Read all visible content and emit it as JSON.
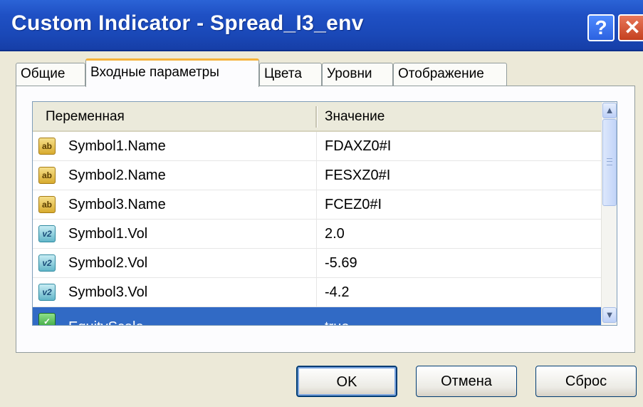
{
  "window": {
    "title": "Custom Indicator - Spread_I3_env"
  },
  "titlebar_buttons": {
    "help": "?",
    "close": "✕"
  },
  "tabs": [
    {
      "label": "Общие"
    },
    {
      "label": "Входные параметры"
    },
    {
      "label": "Цвета"
    },
    {
      "label": "Уровни"
    },
    {
      "label": "Отображение"
    }
  ],
  "table": {
    "headers": {
      "name": "Переменная",
      "value": "Значение"
    },
    "rows": [
      {
        "icon": "ab",
        "name": "Symbol1.Name",
        "value": "FDAXZ0#I"
      },
      {
        "icon": "ab",
        "name": "Symbol2.Name",
        "value": "FESXZ0#I"
      },
      {
        "icon": "ab",
        "name": "Symbol3.Name",
        "value": "FCEZ0#I"
      },
      {
        "icon": "v2",
        "name": "Symbol1.Vol",
        "value": "2.0"
      },
      {
        "icon": "v2",
        "name": "Symbol2.Vol",
        "value": "-5.69"
      },
      {
        "icon": "v2",
        "name": "Symbol3.Vol",
        "value": "-4.2"
      },
      {
        "icon": "✓",
        "name": "EquityScale",
        "value": "true"
      }
    ]
  },
  "scrollbar": {
    "up": "▲",
    "down": "▼"
  },
  "buttons": {
    "ok": "OK",
    "cancel": "Отмена",
    "reset": "Сброс"
  }
}
